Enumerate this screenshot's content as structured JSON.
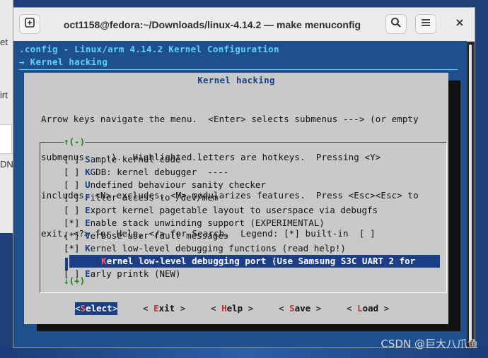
{
  "desktop": {
    "fragments": [
      "et",
      "irt",
      "DN"
    ],
    "watermark": "CSDN @巨大八爪鱼"
  },
  "window": {
    "title": "oct1158@fedora:~/Downloads/linux-4.14.2 — make menuconfig",
    "icons": {
      "new_tab": "new-tab-icon",
      "search": "search-icon",
      "menu": "hamburger-menu-icon",
      "close": "close-icon"
    }
  },
  "terminal": {
    "config_path": ".config - Linux/arm 4.14.2 Kernel Configuration",
    "breadcrumb": "→ Kernel hacking",
    "dialog": {
      "title": "Kernel hacking",
      "help_lines": [
        "Arrow keys navigate the menu.  <Enter> selects submenus ---> (or empty",
        "submenus ----).  Highlighted letters are hotkeys.  Pressing <Y>",
        "includes, <N> excludes, <M> modularizes features.  Press <Esc><Esc> to",
        "exit, <?> for Help, </> for Search.  Legend: [*] built-in  [ ]"
      ],
      "scroll_up": "↑(-)",
      "scroll_down": "↓(+)",
      "items": [
        {
          "prefix": "[ ] ",
          "hotkey": "S",
          "rest": "ample kernel code  ----"
        },
        {
          "prefix": "[ ] ",
          "hotkey": "K",
          "rest": "GDB: kernel debugger  ----"
        },
        {
          "prefix": "[ ] ",
          "hotkey": "U",
          "rest": "ndefined behaviour sanity checker"
        },
        {
          "prefix": "[ ] ",
          "hotkey": "F",
          "rest": "ilter access to /dev/mem"
        },
        {
          "prefix": "[ ] ",
          "hotkey": "E",
          "rest": "xport kernel pagetable layout to userspace via debugfs"
        },
        {
          "prefix": "[*] ",
          "hotkey": "E",
          "rest": "nable stack unwinding support (EXPERIMENTAL)"
        },
        {
          "prefix": "[*] ",
          "hotkey": "V",
          "rest": "erbose user fault messages"
        },
        {
          "prefix": "[*] ",
          "hotkey": "K",
          "rest": "ernel low-level debugging functions (read help!)"
        },
        {
          "prefix": "      ",
          "hotkey": "K",
          "rest": "ernel low-level debugging port (Use Samsung S3C UART 2 for",
          "selected": true
        },
        {
          "prefix": "[ ] ",
          "hotkey": "E",
          "rest": "arly printk (NEW)"
        }
      ],
      "buttons": [
        {
          "lb": "<",
          "hotkey": "S",
          "rest": "elect",
          "rb": ">",
          "active": true
        },
        {
          "lb": "< ",
          "hotkey": "E",
          "rest": "xit",
          "rb": " >"
        },
        {
          "lb": "< ",
          "hotkey": "H",
          "rest": "elp",
          "rb": " >"
        },
        {
          "lb": "< ",
          "hotkey": "S",
          "rest": "ave",
          "rb": " >"
        },
        {
          "lb": "< ",
          "hotkey": "L",
          "rest": "oad",
          "rb": " >"
        }
      ]
    }
  }
}
